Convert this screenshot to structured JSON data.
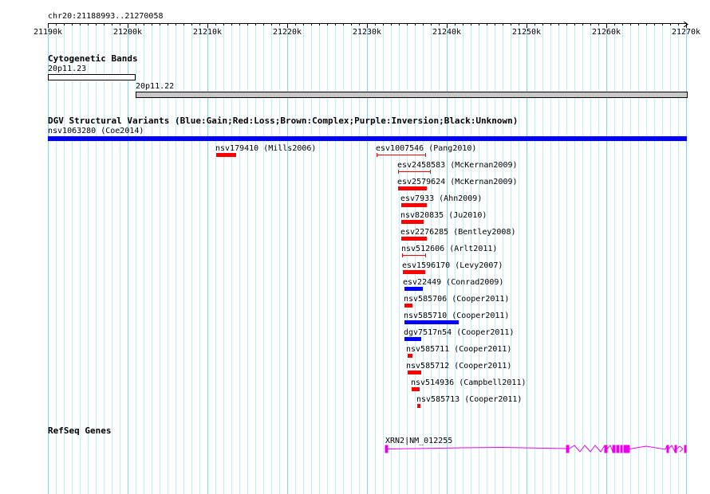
{
  "ruler": {
    "position_label": "chr20:21188993..21270058",
    "ticks": [
      "21190k",
      "21200k",
      "21210k",
      "21220k",
      "21230k",
      "21240k",
      "21250k",
      "21260k",
      "21270k"
    ]
  },
  "cytoband": {
    "title": "Cytogenetic Bands",
    "bands": [
      "20p11.23",
      "20p11.22"
    ]
  },
  "dgv": {
    "title": "DGV Structural Variants (Blue:Gain;Red:Loss;Brown:Complex;Purple:Inversion;Black:Unknown)",
    "colors": {
      "gain": "#0000ff",
      "loss": "#ff0000"
    },
    "variants": [
      "nsv1063280 (Coe2014)",
      "nsv179410 (Mills2006)",
      "esv1007546 (Pang2010)",
      "esv2458583 (McKernan2009)",
      "esv2579624 (McKernan2009)",
      "esv7933 (Ahn2009)",
      "nsv820835 (Ju2010)",
      "esv2276285 (Bentley2008)",
      "nsv512606 (Arlt2011)",
      "esv1596170 (Levy2007)",
      "esv22449 (Conrad2009)",
      "nsv585706 (Cooper2011)",
      "nsv585710 (Cooper2011)",
      "dgv7517n54 (Cooper2011)",
      "nsv585711 (Cooper2011)",
      "nsv585712 (Cooper2011)",
      "nsv514936 (Campbell2011)",
      "nsv585713 (Cooper2011)"
    ]
  },
  "refseq": {
    "title": "RefSeq Genes",
    "gene_label": "XRN2|NM_012255",
    "color": "#ee00ee"
  }
}
